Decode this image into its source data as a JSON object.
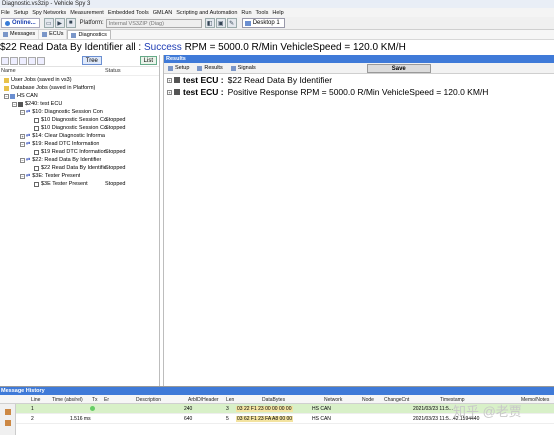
{
  "window": {
    "title": "Diagnostic.vs3zip - Vehicle Spy 3"
  },
  "menu": [
    "File",
    "Setup",
    "Spy Networks",
    "Measurement",
    "Embedded Tools",
    "GMLAN",
    "Scripting and Automation",
    "Run",
    "Tools",
    "Help"
  ],
  "toolbar": {
    "online_label": "Online...",
    "platform_label": "Platform:",
    "platform_value": "Internal VS3ZIP (Diag)",
    "desktop_tab": "Desktop 1"
  },
  "subtabs": [
    "Messages",
    "ECUs",
    "Diagnostics"
  ],
  "status_line": {
    "prefix": "$22 Read Data By Identifier all :",
    "success": "Success",
    "rest": "RPM = 5000.0 R/Min VehicleSpeed = 120.0 KM/H"
  },
  "left_panel": {
    "tree_button": "Tree",
    "list_button": "List",
    "col_name": "Name",
    "col_status": "Status",
    "rows": [
      {
        "label": "User Jobs (saved in vs3)",
        "status": ""
      },
      {
        "label": "Database Jobs (saved in Platform)",
        "status": ""
      },
      {
        "label": "HS CAN",
        "status": ""
      },
      {
        "label": "$240: test ECU",
        "status": ""
      },
      {
        "label": "$10: Diagnostic Session Con",
        "status": ""
      },
      {
        "label": "$10 Diagnostic Session Co",
        "status": "Stopped"
      },
      {
        "label": "$10 Diagnostic Session Co",
        "status": "Stopped"
      },
      {
        "label": "$14: Clear Diagnostic Informa",
        "status": ""
      },
      {
        "label": "$19: Read DTC Information",
        "status": ""
      },
      {
        "label": "$19 Read DTC Information",
        "status": "Stopped"
      },
      {
        "label": "$22: Read Data By Identifier",
        "status": ""
      },
      {
        "label": "$22 Read Data By Identifie",
        "status": "Stopped"
      },
      {
        "label": "$3E: Tester Present",
        "status": ""
      },
      {
        "label": "$3E Tester Present",
        "status": "Stopped"
      }
    ]
  },
  "right_panel": {
    "title": "Results",
    "tabs": [
      "Setup",
      "Results",
      "Signals"
    ],
    "save_label": "Save",
    "results": [
      {
        "ecu": "test ECU :",
        "text": "$22 Read Data By Identifier"
      },
      {
        "ecu": "test ECU :",
        "text": "Positive Response RPM = 5000.0 R/Min VehicleSpeed = 120.0 KM/H"
      }
    ]
  },
  "message_history": {
    "title": "Message History",
    "headers": [
      "Line",
      "Time (abs/rel)",
      "Tx",
      "Er",
      "Description",
      "ArbID/Header",
      "Len",
      "DataBytes",
      "Network",
      "Node",
      "ChangeCnt",
      "Timestamp",
      "Memo/Notes"
    ],
    "rows": [
      {
        "line": "1",
        "time": "",
        "arbid": "240",
        "len": "3",
        "bytes": "03 22 F1 23 00 00 00 00",
        "network": "HS CAN",
        "timestamp": "2021/03/23 11:5..."
      },
      {
        "line": "2",
        "time": "1.516 ms",
        "arbid": "640",
        "len": "5",
        "bytes": "03 62 F1 23 FA A8 00 00",
        "network": "HS CAN",
        "timestamp": "2021/03/23 11:5...42.1594440"
      }
    ]
  },
  "watermark": "知乎 @老贾"
}
